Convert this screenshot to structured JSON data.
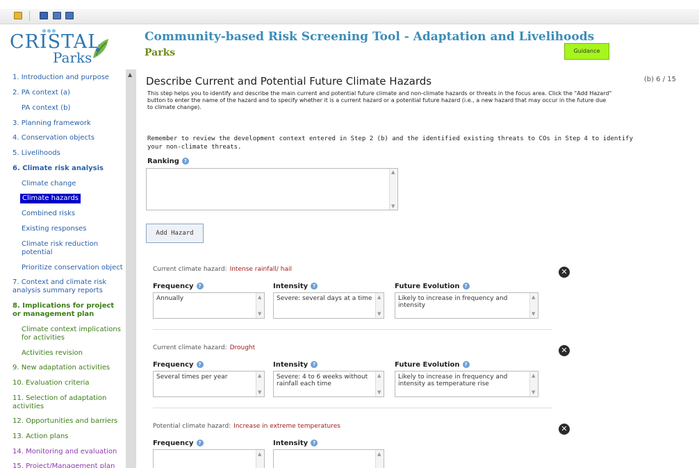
{
  "app": {
    "logo_name": "CRISTAL",
    "logo_sub": "Parks",
    "title": "Community-based Risk Screening Tool - Adaptation and Livelihoods",
    "subtitle": "Parks",
    "guidance_label": "Guidance"
  },
  "toolbar": {
    "icons": [
      "folder-icon",
      "save-icon",
      "print-icon",
      "export-icon"
    ]
  },
  "sidebar": {
    "items": [
      {
        "label": "1. Introduction and purpose",
        "color": "#2a5fa8"
      },
      {
        "label": "2. PA context (a)",
        "color": "#2a5fa8"
      },
      {
        "label": "PA context (b)",
        "color": "#2a5fa8"
      },
      {
        "label": "3. Planning framework",
        "color": "#2a5fa8"
      },
      {
        "label": "4. Conservation objects",
        "color": "#2a5fa8"
      },
      {
        "label": "5. Livelihoods",
        "color": "#2a5fa8"
      },
      {
        "label": "6. Climate risk analysis",
        "color": "#2a5fa8"
      },
      {
        "label": "Climate change",
        "color": "#2a5fa8"
      },
      {
        "label": "Climate hazards",
        "color": "#ffffff",
        "active": true
      },
      {
        "label": "Combined risks",
        "color": "#2a5fa8"
      },
      {
        "label": "Existing responses",
        "color": "#2a5fa8"
      },
      {
        "label": "Climate risk reduction",
        "color": "#2a5fa8"
      },
      {
        "label": "potential",
        "color": "#2a5fa8"
      },
      {
        "label": "Prioritize conservation object",
        "color": "#2a5fa8"
      },
      {
        "label": "7. Context and climate risk",
        "color": "#2a5fa8"
      },
      {
        "label": "analysis summary reports",
        "color": "#2a5fa8"
      },
      {
        "label": "8. Implications for project",
        "color": "#3d7d18"
      },
      {
        "label": "or management plan",
        "color": "#3d7d18"
      },
      {
        "label": "Climate context implications",
        "color": "#3d7d18"
      },
      {
        "label": "for activities",
        "color": "#3d7d18"
      },
      {
        "label": "Activities revision",
        "color": "#3d7d18"
      },
      {
        "label": "9. New adaptation activities",
        "color": "#3d7d18"
      },
      {
        "label": "10. Evaluation criteria",
        "color": "#3d7d18"
      },
      {
        "label": "11. Selection of adaptation",
        "color": "#3d7d18"
      },
      {
        "label": "activities",
        "color": "#3d7d18"
      },
      {
        "label": "12. Opportunities and barriers",
        "color": "#3d7d18"
      },
      {
        "label": "13. Action plans",
        "color": "#3d7d18"
      },
      {
        "label": "14. Monitoring and evaluation",
        "color": "#8d3ab0"
      },
      {
        "label": "15. Project/Management plan",
        "color": "#8d3ab0"
      }
    ]
  },
  "main": {
    "heading": "Describe Current and Potential Future Climate Hazards",
    "counter": "(b) 6 / 15",
    "intro": "This step helps you to identify and describe the main current and potential future climate and non-climate hazards or threats in the focus area. Click the \"Add Hazard\" button to enter the name of the hazard and to specify whether it is a current hazard or a potential future hazard (i.e., a new hazard that may occur in the future due to climate change).",
    "reminder": "Remember to review the development context entered in Step 2 (b) and the identified existing threats to COs in Step 4 to identify your non-climate threats.",
    "ranking_label": "Ranking",
    "ranking_value": "",
    "add_hazard_label": "Add Hazard"
  },
  "hazards": [
    {
      "type_label": "Current climate hazard:",
      "name": "Intense rainfall/ hail",
      "frequency_label": "Frequency",
      "intensity_label": "Intensity",
      "future_label": "Future Evolution",
      "frequency": "Annually",
      "intensity": "Severe: several days at a time",
      "future": "Likely to increase in frequency and intensity"
    },
    {
      "type_label": "Current climate hazard:",
      "name": "Drought",
      "frequency_label": "Frequency",
      "intensity_label": "Intensity",
      "future_label": "Future Evolution",
      "frequency": "Several times per year",
      "intensity": "Severe: 4 to 6 weeks without rainfall each time",
      "future": "Likely to increase in frequency and intensity as temperature rise"
    },
    {
      "type_label": "Potential climate hazard:",
      "name": "Increase in extreme temperatures",
      "frequency_label": "Frequency",
      "intensity_label": "Intensity",
      "frequency": "",
      "intensity": ""
    }
  ]
}
